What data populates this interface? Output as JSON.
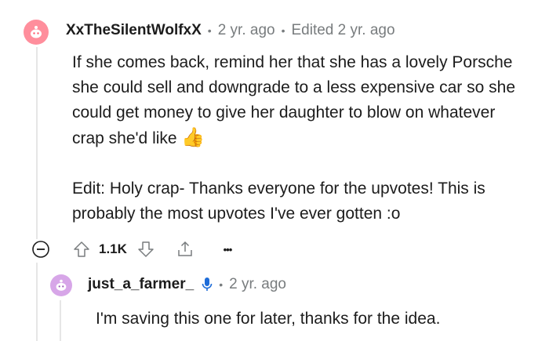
{
  "comment": {
    "username": "XxTheSilentWolfxX",
    "age": "2 yr. ago",
    "edited": "Edited 2 yr. ago",
    "paragraphs": [
      "If she comes back, remind her that she has a lovely Porsche she could sell and downgrade to a less expensive car so she could get money to give her daughter to blow on whatever crap she'd like",
      "Edit: Holy crap- Thanks everyone for the upvotes! This is probably the most upvotes I've ever gotten :o"
    ],
    "emoji": "👍",
    "score": "1.1K",
    "more": "•••"
  },
  "reply": {
    "username": "just_a_farmer_",
    "age": "2 yr. ago",
    "body": "I'm saving this one for later, thanks for the idea."
  },
  "icons": [
    "collapse-icon",
    "upvote-icon",
    "downvote-icon",
    "share-icon",
    "more-icon",
    "microphone-icon",
    "avatar-icon"
  ],
  "colors": {
    "avatar1": "#ff8e9c",
    "avatar2": "#d7a6e8",
    "mic": "#1e6cd8",
    "emoji": "#f5b01a"
  }
}
